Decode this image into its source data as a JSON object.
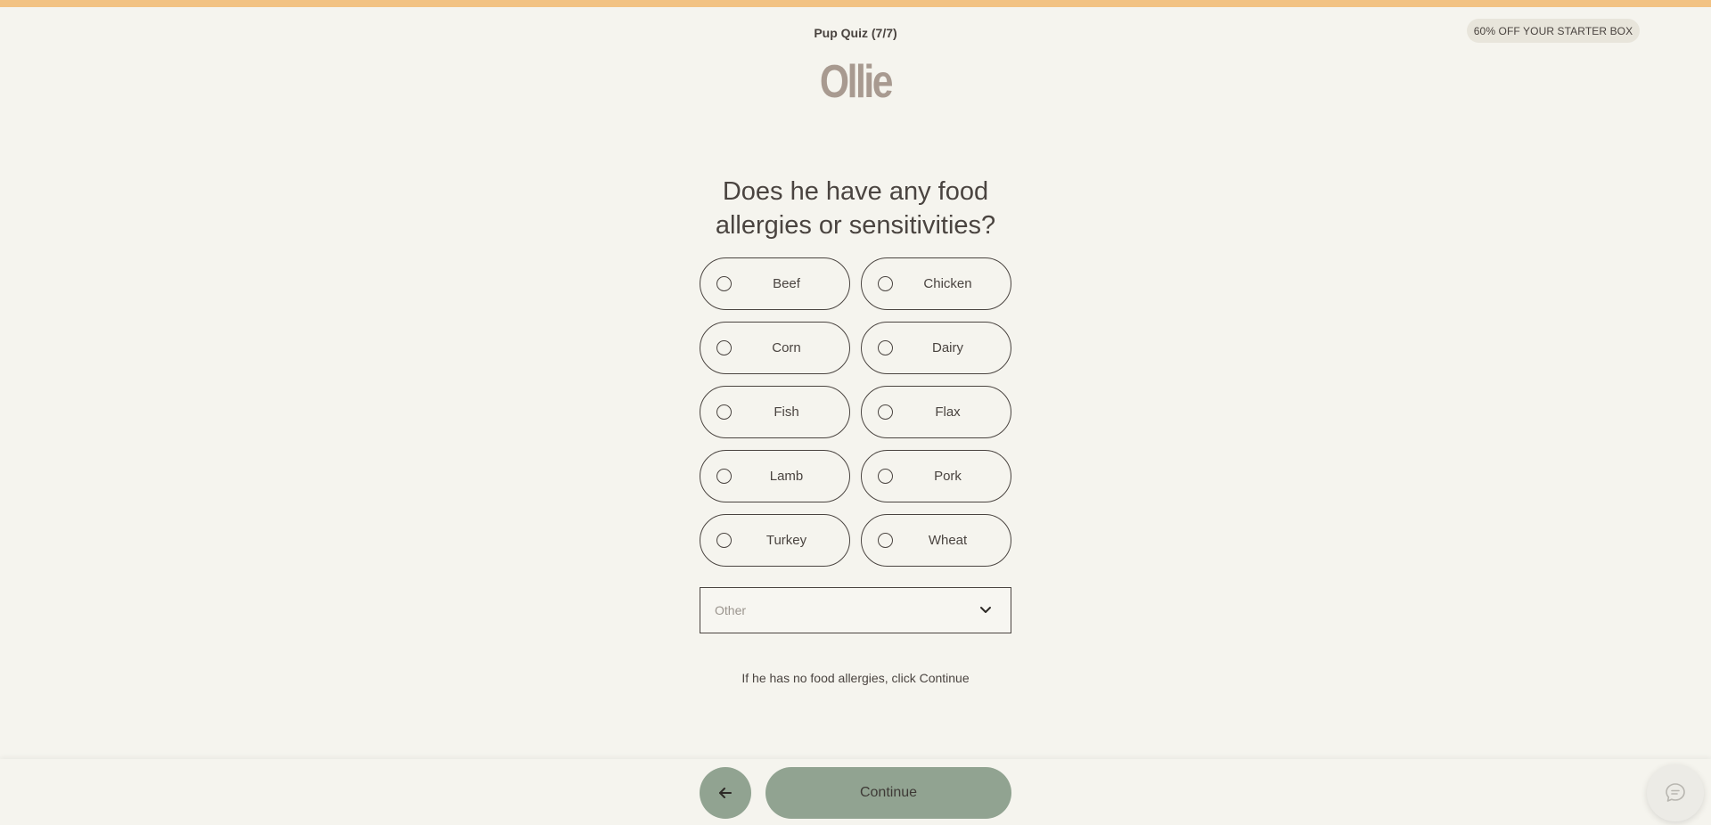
{
  "header": {
    "quiz_step": "Pup Quiz (7/7)",
    "promo": "60% OFF YOUR STARTER BOX",
    "logo_text": "Ollie"
  },
  "question": {
    "text": "Does he have any food allergies or sensitivities?"
  },
  "options": [
    {
      "label": "Beef",
      "selected": false
    },
    {
      "label": "Chicken",
      "selected": false
    },
    {
      "label": "Corn",
      "selected": false
    },
    {
      "label": "Dairy",
      "selected": false
    },
    {
      "label": "Fish",
      "selected": false
    },
    {
      "label": "Flax",
      "selected": false
    },
    {
      "label": "Lamb",
      "selected": false
    },
    {
      "label": "Pork",
      "selected": false
    },
    {
      "label": "Turkey",
      "selected": false
    },
    {
      "label": "Wheat",
      "selected": false
    }
  ],
  "other_select": {
    "placeholder": "Other"
  },
  "hint": "If he has no food allergies, click Continue",
  "footer": {
    "continue_label": "Continue"
  },
  "colors": {
    "accent_stripe": "#f2c283",
    "button_green": "#91a391",
    "background": "#f5f4ee",
    "text": "#4a4440"
  },
  "icons": {
    "back": "arrow-left-icon",
    "select": "chevron-down-icon",
    "chat": "chat-bubble-icon"
  }
}
